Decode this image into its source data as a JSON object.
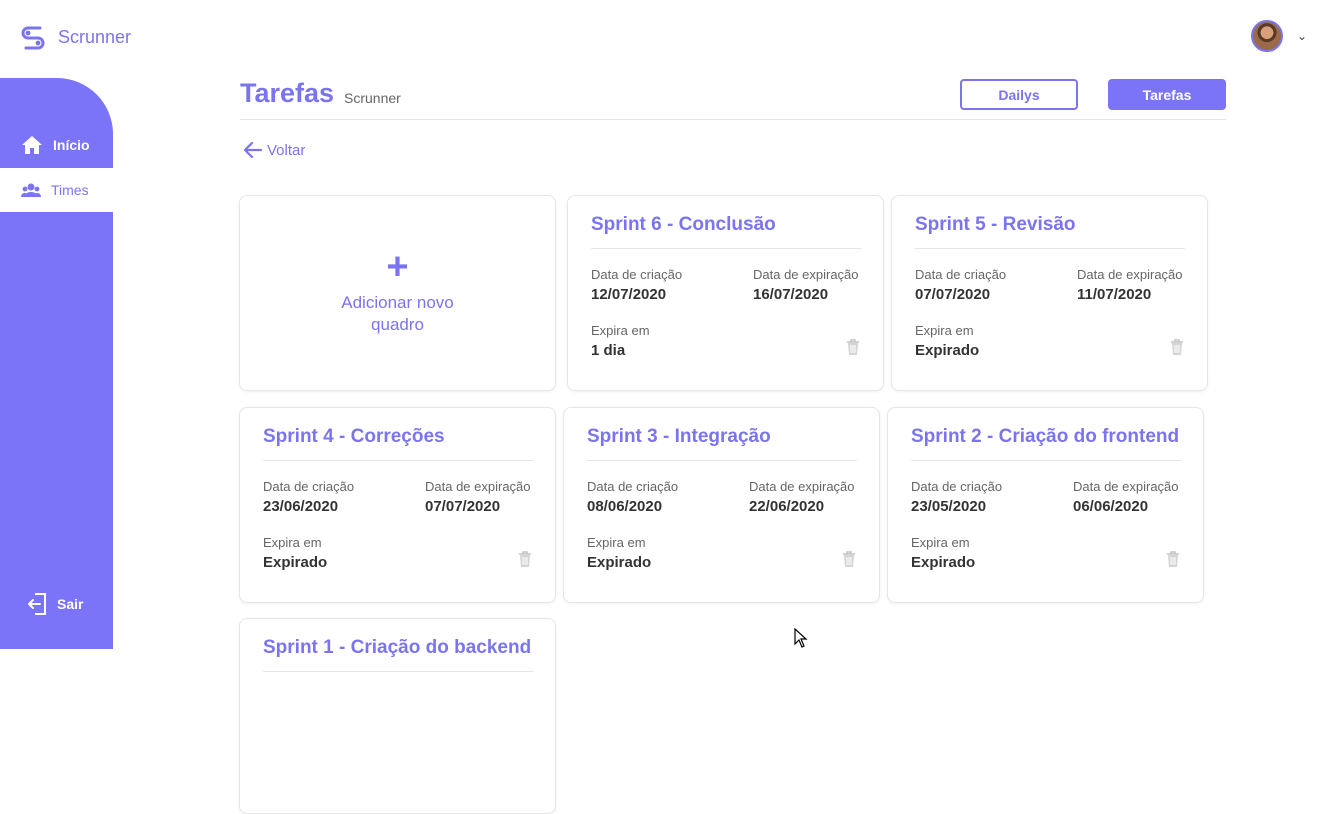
{
  "app": {
    "name": "Scrunner"
  },
  "sidebar": {
    "items": [
      {
        "label": "Início",
        "icon": "home-icon"
      },
      {
        "label": "Times",
        "icon": "users-icon"
      }
    ],
    "exit_label": "Sair"
  },
  "header": {
    "title": "Tarefas",
    "subtitle": "Scrunner"
  },
  "toolbar": {
    "dailys_label": "Dailys",
    "tarefas_label": "Tarefas"
  },
  "back_label": "Voltar",
  "add_card": {
    "label": "Adicionar novo quadro"
  },
  "labels": {
    "created": "Data de criação",
    "expires_date": "Data de expiração",
    "expires_in": "Expira em"
  },
  "boards": [
    {
      "title": "Sprint 6 - Conclusão",
      "created": "12/07/2020",
      "expiration": "16/07/2020",
      "expires_in": "1 dia"
    },
    {
      "title": "Sprint 5 - Revisão",
      "created": "07/07/2020",
      "expiration": "11/07/2020",
      "expires_in": "Expirado"
    },
    {
      "title": "Sprint 4 - Correções",
      "created": "23/06/2020",
      "expiration": "07/07/2020",
      "expires_in": "Expirado"
    },
    {
      "title": "Sprint 3 - Integração",
      "created": "08/06/2020",
      "expiration": "22/06/2020",
      "expires_in": "Expirado"
    },
    {
      "title": "Sprint 2 - Criação do frontend",
      "created": "23/05/2020",
      "expiration": "06/06/2020",
      "expires_in": "Expirado"
    },
    {
      "title": "Sprint 1 - Criação do backend"
    }
  ],
  "colors": {
    "accent": "#7b74f8",
    "text": "#333333",
    "muted": "#666666"
  }
}
